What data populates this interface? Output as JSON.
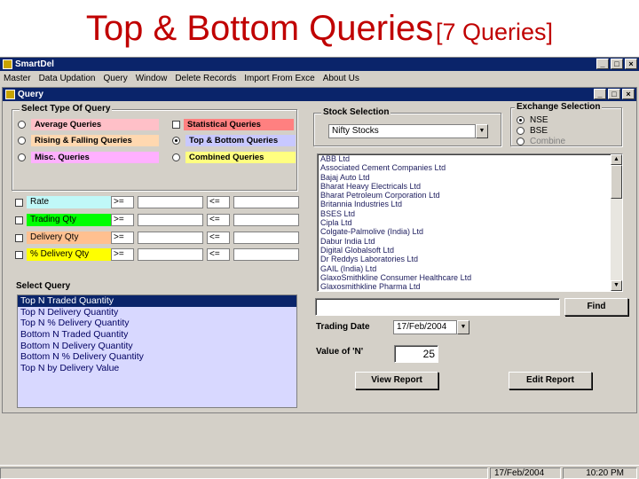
{
  "slide": {
    "title_main": "Top & Bottom Queries",
    "title_sub": "[7 Queries]"
  },
  "app": {
    "title": "SmartDel",
    "menu": [
      "Master",
      "Data Updation",
      "Query",
      "Window",
      "Delete Records",
      "Import From Exce",
      "About Us"
    ]
  },
  "window": {
    "title": "Query",
    "buttons": {
      "minimize": "_",
      "maximize": "□",
      "close": "×"
    }
  },
  "query_type": {
    "label": "Select Type Of Query",
    "options": [
      {
        "label": "Average Queries",
        "color": "#ffc0c8",
        "selected": false
      },
      {
        "label": "Statistical Queries",
        "color": "#ff8080",
        "selected": false
      },
      {
        "label": "Rising & Falling Queries",
        "color": "#ffd8b0",
        "selected": false
      },
      {
        "label": "Top & Bottom Queries",
        "color": "#c8c8ff",
        "selected": true
      },
      {
        "label": "Misc. Queries",
        "color": "#ffb0ff",
        "selected": false
      },
      {
        "label": "Combined Queries",
        "color": "#ffff80",
        "selected": false
      }
    ]
  },
  "filters": [
    {
      "label": "Rate",
      "color": "#c0f8f8",
      "op1": ">=",
      "op2": "<="
    },
    {
      "label": "Trading Qty",
      "color": "#00ff00",
      "op1": ">=",
      "op2": "<="
    },
    {
      "label": "Delivery Qty",
      "color": "#ffc090",
      "op1": ">=",
      "op2": "<="
    },
    {
      "label": "% Delivery Qty",
      "color": "#ffff00",
      "op1": ">=",
      "op2": "<="
    }
  ],
  "stock_selection": {
    "label": "Stock Selection",
    "selected": "Nifty Stocks",
    "stocks": [
      "ABB Ltd",
      "Associated Cement Companies Ltd",
      "Bajaj Auto Ltd",
      "Bharat Heavy Electricals Ltd",
      "Bharat Petroleum Corporation Ltd",
      "Britannia Industries Ltd",
      "BSES Ltd",
      "Cipla Ltd",
      "Colgate-Palmolive (India) Ltd",
      "Dabur India Ltd",
      "Digital Globalsoft Ltd",
      "Dr Reddys Laboratories Ltd",
      "GAIL (India) Ltd",
      "GlaxoSmithkline Consumer Healthcare Ltd",
      "Glaxosmithkline Pharma Ltd"
    ]
  },
  "exchange": {
    "label": "Exchange Selection",
    "options": [
      {
        "label": "NSE",
        "selected": true,
        "disabled": false
      },
      {
        "label": "BSE",
        "selected": false,
        "disabled": false
      },
      {
        "label": "Combine",
        "selected": false,
        "disabled": true
      }
    ]
  },
  "select_query": {
    "label": "Select Query",
    "items": [
      "Top N Traded Quantity",
      "Top N Delivery Quantity",
      "Top N % Delivery Quantity",
      "Bottom N Traded Quantity",
      "Bottom N Delivery Quantity",
      "Bottom N % Delivery Quantity",
      "Top N by Delivery Value"
    ],
    "selected_index": 0
  },
  "find": {
    "value": "",
    "button": "Find"
  },
  "trading_date": {
    "label": "Trading Date",
    "value": "17/Feb/2004"
  },
  "n_value": {
    "label": "Value of 'N'",
    "value": "25"
  },
  "buttons": {
    "view_report": "View Report",
    "edit_report": "Edit Report"
  },
  "status": {
    "date": "17/Feb/2004",
    "time": "10:20 PM"
  }
}
